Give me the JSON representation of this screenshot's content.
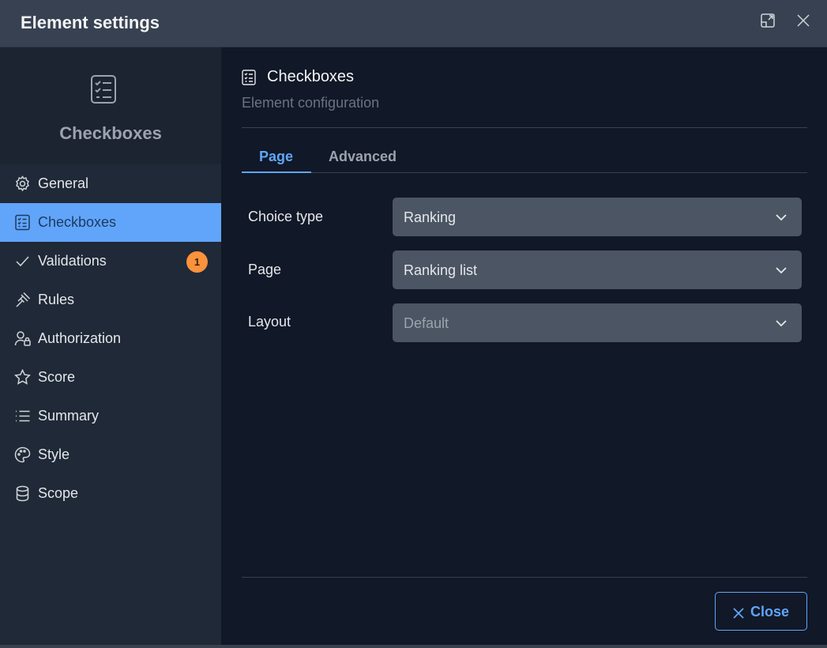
{
  "header": {
    "title": "Element settings",
    "expand_icon": "expand-icon",
    "close_icon": "close-icon"
  },
  "sidebar": {
    "head_icon": "checklist-icon",
    "head_title": "Checkboxes",
    "items": [
      {
        "label": "General",
        "icon": "gear-icon"
      },
      {
        "label": "Checkboxes",
        "icon": "checklist-icon",
        "active": true
      },
      {
        "label": "Validations",
        "icon": "check-icon",
        "badge": "1"
      },
      {
        "label": "Rules",
        "icon": "gavel-icon"
      },
      {
        "label": "Authorization",
        "icon": "user-lock-icon"
      },
      {
        "label": "Score",
        "icon": "star-icon"
      },
      {
        "label": "Summary",
        "icon": "list-icon"
      },
      {
        "label": "Style",
        "icon": "palette-icon"
      },
      {
        "label": "Scope",
        "icon": "database-icon"
      }
    ]
  },
  "content": {
    "title": "Checkboxes",
    "subtitle": "Element configuration",
    "tabs": [
      {
        "label": "Page",
        "active": true
      },
      {
        "label": "Advanced",
        "active": false
      }
    ],
    "fields": [
      {
        "label": "Choice type",
        "value": "Ranking"
      },
      {
        "label": "Page",
        "value": "Ranking list"
      },
      {
        "label": "Layout",
        "value": "Default"
      }
    ],
    "close_label": "Close"
  },
  "colors": {
    "accent": "#60a5fa",
    "badge": "#fb923c",
    "background": "#111827",
    "sidebar": "#1f2937"
  }
}
